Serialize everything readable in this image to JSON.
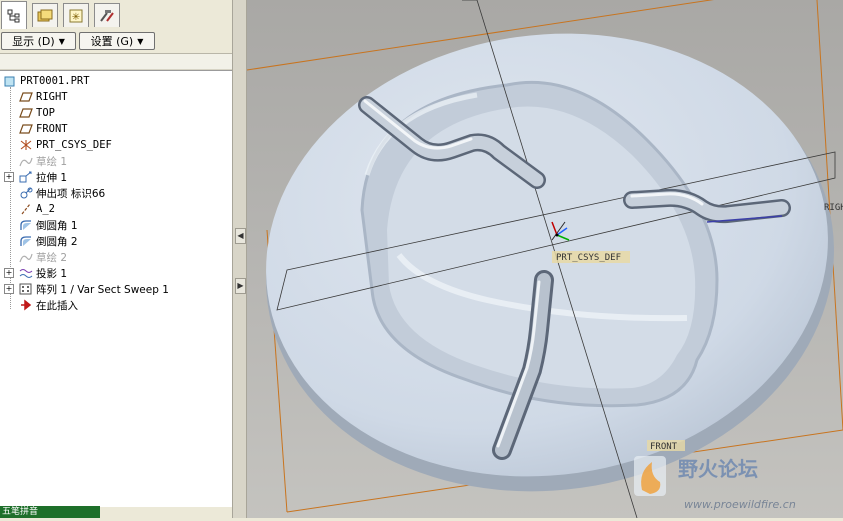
{
  "tabs": [
    {
      "name": "model-tree-tab",
      "icon": "model-tree-icon"
    },
    {
      "name": "folder-browser-tab",
      "icon": "folder-icon"
    },
    {
      "name": "favorites-tab",
      "icon": "star-icon"
    },
    {
      "name": "connections-tab",
      "icon": "tools-icon"
    }
  ],
  "toolbar": {
    "display_label": "显示 (D)",
    "settings_label": "设置 (G)"
  },
  "tree": [
    {
      "label": "PRT0001.PRT",
      "icon": "part-icon",
      "indent": 0,
      "gray": false,
      "mono": true
    },
    {
      "label": "RIGHT",
      "icon": "datum-plane-icon",
      "indent": 1,
      "gray": false,
      "mono": true
    },
    {
      "label": "TOP",
      "icon": "datum-plane-icon",
      "indent": 1,
      "gray": false,
      "mono": true
    },
    {
      "label": "FRONT",
      "icon": "datum-plane-icon",
      "indent": 1,
      "gray": false,
      "mono": true
    },
    {
      "label": "PRT_CSYS_DEF",
      "icon": "csys-icon",
      "indent": 1,
      "gray": false,
      "mono": true
    },
    {
      "label": "草绘 1",
      "icon": "sketch-icon",
      "indent": 1,
      "gray": true,
      "mono": false
    },
    {
      "label": "拉伸 1",
      "icon": "extrude-icon",
      "indent": 1,
      "gray": false,
      "mono": false,
      "expand": true
    },
    {
      "label": "伸出项 标识66",
      "icon": "protrusion-icon",
      "indent": 1,
      "gray": false,
      "mono": false
    },
    {
      "label": "A_2",
      "icon": "axis-icon",
      "indent": 1,
      "gray": false,
      "mono": true
    },
    {
      "label": "倒圆角 1",
      "icon": "round-icon",
      "indent": 1,
      "gray": false,
      "mono": false
    },
    {
      "label": "倒圆角 2",
      "icon": "round-icon",
      "indent": 1,
      "gray": false,
      "mono": false
    },
    {
      "label": "草绘 2",
      "icon": "sketch-icon",
      "indent": 1,
      "gray": true,
      "mono": false
    },
    {
      "label": "投影 1",
      "icon": "projection-icon",
      "indent": 1,
      "gray": false,
      "mono": false,
      "expand": true
    },
    {
      "label": "阵列 1 / Var Sect Sweep 1",
      "icon": "pattern-icon",
      "indent": 1,
      "gray": false,
      "mono": false,
      "expand": true
    },
    {
      "label": "在此插入",
      "icon": "insert-arrow-icon",
      "indent": 1,
      "gray": false,
      "mono": false
    }
  ],
  "ime_label": "五笔拼音",
  "viewport": {
    "labels": {
      "right": "RIGHT",
      "front": "FRONT",
      "csys": "PRT_CSYS_DEF"
    }
  },
  "watermark": {
    "title": "野火论坛",
    "url": "www.proewildfire.cn"
  },
  "colors": {
    "part": "#cdd8e6",
    "datum": "#d07a2a",
    "background": "#b5b4b0"
  }
}
